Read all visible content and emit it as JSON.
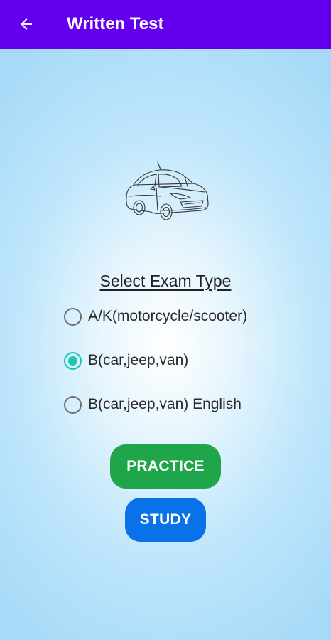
{
  "appbar": {
    "title": "Written Test",
    "back_icon": "arrow-left-icon",
    "color": "#6200ee"
  },
  "illustration": {
    "icon": "car-line-drawing"
  },
  "exam": {
    "heading": "Select Exam Type",
    "options": [
      {
        "label": "A/K(motorcycle/scooter)",
        "selected": false
      },
      {
        "label": "B(car,jeep,van)",
        "selected": true
      },
      {
        "label": "B(car,jeep,van) English",
        "selected": false
      }
    ],
    "selected_color": "#1cc6b5"
  },
  "actions": {
    "practice_label": "PRACTICE",
    "practice_color": "#1fa64a",
    "study_label": "STUDY",
    "study_color": "#0a72e9"
  }
}
